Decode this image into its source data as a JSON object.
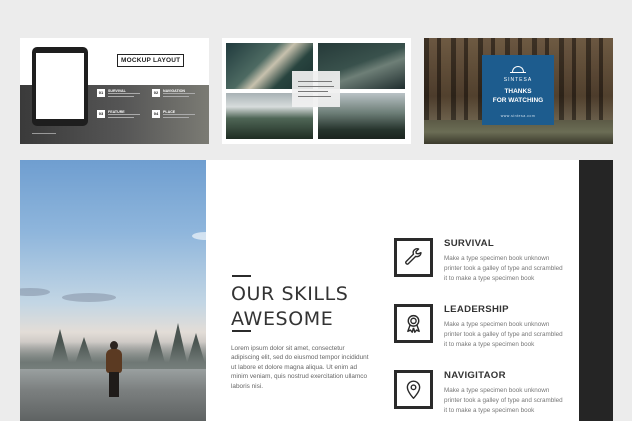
{
  "thumb1": {
    "label": "MOCKUP LAYOUT",
    "features": [
      {
        "num": "01",
        "label": "SURVIVAL"
      },
      {
        "num": "02",
        "label": "NAVIGATION"
      },
      {
        "num": "03",
        "label": "FEATURE"
      },
      {
        "num": "04",
        "label": "PLACE"
      }
    ]
  },
  "thumb3": {
    "brand": "SINTESA",
    "title_line1": "THANKS",
    "title_line2": "FOR WATCHING",
    "caption": "www.sintesa.com"
  },
  "slide": {
    "heading_line1": "OUR SKILLS",
    "heading_line2": "AWESOME",
    "intro": "Lorem ipsum dolor sit amet, consectetur adipiscing elit, sed do eiusmod tempor incididunt ut labore et dolore magna aliqua. Ut enim ad minim veniam, quis nostrud exercitation ullamco laboris nisi.",
    "skills": [
      {
        "title": "SURVIVAL",
        "desc": "Make a type specimen book unknown printer took a galley of type and scrambled it to make a type specimen book",
        "icon": "wrench-icon"
      },
      {
        "title": "LEADERSHIP",
        "desc": "Make a type specimen book unknown printer took a galley of type and scrambled it to make a type specimen book",
        "icon": "award-ribbon-icon"
      },
      {
        "title": "NAVIGITAOR",
        "desc": "Make a type specimen book unknown printer took a galley of type and scrambled it to make a type specimen book",
        "icon": "map-pin-icon"
      }
    ]
  },
  "colors": {
    "accent_blue": "#1d5c8e",
    "dark": "#252525",
    "text": "#333333"
  }
}
